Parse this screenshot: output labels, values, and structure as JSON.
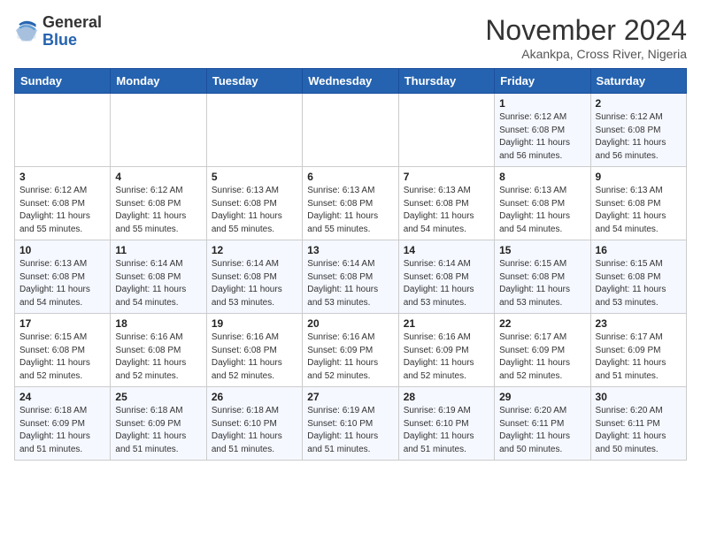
{
  "logo": {
    "line1": "General",
    "line2": "Blue"
  },
  "title": "November 2024",
  "subtitle": "Akankpa, Cross River, Nigeria",
  "days_header": [
    "Sunday",
    "Monday",
    "Tuesday",
    "Wednesday",
    "Thursday",
    "Friday",
    "Saturday"
  ],
  "weeks": [
    [
      {
        "num": "",
        "detail": ""
      },
      {
        "num": "",
        "detail": ""
      },
      {
        "num": "",
        "detail": ""
      },
      {
        "num": "",
        "detail": ""
      },
      {
        "num": "",
        "detail": ""
      },
      {
        "num": "1",
        "detail": "Sunrise: 6:12 AM\nSunset: 6:08 PM\nDaylight: 11 hours\nand 56 minutes."
      },
      {
        "num": "2",
        "detail": "Sunrise: 6:12 AM\nSunset: 6:08 PM\nDaylight: 11 hours\nand 56 minutes."
      }
    ],
    [
      {
        "num": "3",
        "detail": "Sunrise: 6:12 AM\nSunset: 6:08 PM\nDaylight: 11 hours\nand 55 minutes."
      },
      {
        "num": "4",
        "detail": "Sunrise: 6:12 AM\nSunset: 6:08 PM\nDaylight: 11 hours\nand 55 minutes."
      },
      {
        "num": "5",
        "detail": "Sunrise: 6:13 AM\nSunset: 6:08 PM\nDaylight: 11 hours\nand 55 minutes."
      },
      {
        "num": "6",
        "detail": "Sunrise: 6:13 AM\nSunset: 6:08 PM\nDaylight: 11 hours\nand 55 minutes."
      },
      {
        "num": "7",
        "detail": "Sunrise: 6:13 AM\nSunset: 6:08 PM\nDaylight: 11 hours\nand 54 minutes."
      },
      {
        "num": "8",
        "detail": "Sunrise: 6:13 AM\nSunset: 6:08 PM\nDaylight: 11 hours\nand 54 minutes."
      },
      {
        "num": "9",
        "detail": "Sunrise: 6:13 AM\nSunset: 6:08 PM\nDaylight: 11 hours\nand 54 minutes."
      }
    ],
    [
      {
        "num": "10",
        "detail": "Sunrise: 6:13 AM\nSunset: 6:08 PM\nDaylight: 11 hours\nand 54 minutes."
      },
      {
        "num": "11",
        "detail": "Sunrise: 6:14 AM\nSunset: 6:08 PM\nDaylight: 11 hours\nand 54 minutes."
      },
      {
        "num": "12",
        "detail": "Sunrise: 6:14 AM\nSunset: 6:08 PM\nDaylight: 11 hours\nand 53 minutes."
      },
      {
        "num": "13",
        "detail": "Sunrise: 6:14 AM\nSunset: 6:08 PM\nDaylight: 11 hours\nand 53 minutes."
      },
      {
        "num": "14",
        "detail": "Sunrise: 6:14 AM\nSunset: 6:08 PM\nDaylight: 11 hours\nand 53 minutes."
      },
      {
        "num": "15",
        "detail": "Sunrise: 6:15 AM\nSunset: 6:08 PM\nDaylight: 11 hours\nand 53 minutes."
      },
      {
        "num": "16",
        "detail": "Sunrise: 6:15 AM\nSunset: 6:08 PM\nDaylight: 11 hours\nand 53 minutes."
      }
    ],
    [
      {
        "num": "17",
        "detail": "Sunrise: 6:15 AM\nSunset: 6:08 PM\nDaylight: 11 hours\nand 52 minutes."
      },
      {
        "num": "18",
        "detail": "Sunrise: 6:16 AM\nSunset: 6:08 PM\nDaylight: 11 hours\nand 52 minutes."
      },
      {
        "num": "19",
        "detail": "Sunrise: 6:16 AM\nSunset: 6:08 PM\nDaylight: 11 hours\nand 52 minutes."
      },
      {
        "num": "20",
        "detail": "Sunrise: 6:16 AM\nSunset: 6:09 PM\nDaylight: 11 hours\nand 52 minutes."
      },
      {
        "num": "21",
        "detail": "Sunrise: 6:16 AM\nSunset: 6:09 PM\nDaylight: 11 hours\nand 52 minutes."
      },
      {
        "num": "22",
        "detail": "Sunrise: 6:17 AM\nSunset: 6:09 PM\nDaylight: 11 hours\nand 52 minutes."
      },
      {
        "num": "23",
        "detail": "Sunrise: 6:17 AM\nSunset: 6:09 PM\nDaylight: 11 hours\nand 51 minutes."
      }
    ],
    [
      {
        "num": "24",
        "detail": "Sunrise: 6:18 AM\nSunset: 6:09 PM\nDaylight: 11 hours\nand 51 minutes."
      },
      {
        "num": "25",
        "detail": "Sunrise: 6:18 AM\nSunset: 6:09 PM\nDaylight: 11 hours\nand 51 minutes."
      },
      {
        "num": "26",
        "detail": "Sunrise: 6:18 AM\nSunset: 6:10 PM\nDaylight: 11 hours\nand 51 minutes."
      },
      {
        "num": "27",
        "detail": "Sunrise: 6:19 AM\nSunset: 6:10 PM\nDaylight: 11 hours\nand 51 minutes."
      },
      {
        "num": "28",
        "detail": "Sunrise: 6:19 AM\nSunset: 6:10 PM\nDaylight: 11 hours\nand 51 minutes."
      },
      {
        "num": "29",
        "detail": "Sunrise: 6:20 AM\nSunset: 6:11 PM\nDaylight: 11 hours\nand 50 minutes."
      },
      {
        "num": "30",
        "detail": "Sunrise: 6:20 AM\nSunset: 6:11 PM\nDaylight: 11 hours\nand 50 minutes."
      }
    ]
  ]
}
